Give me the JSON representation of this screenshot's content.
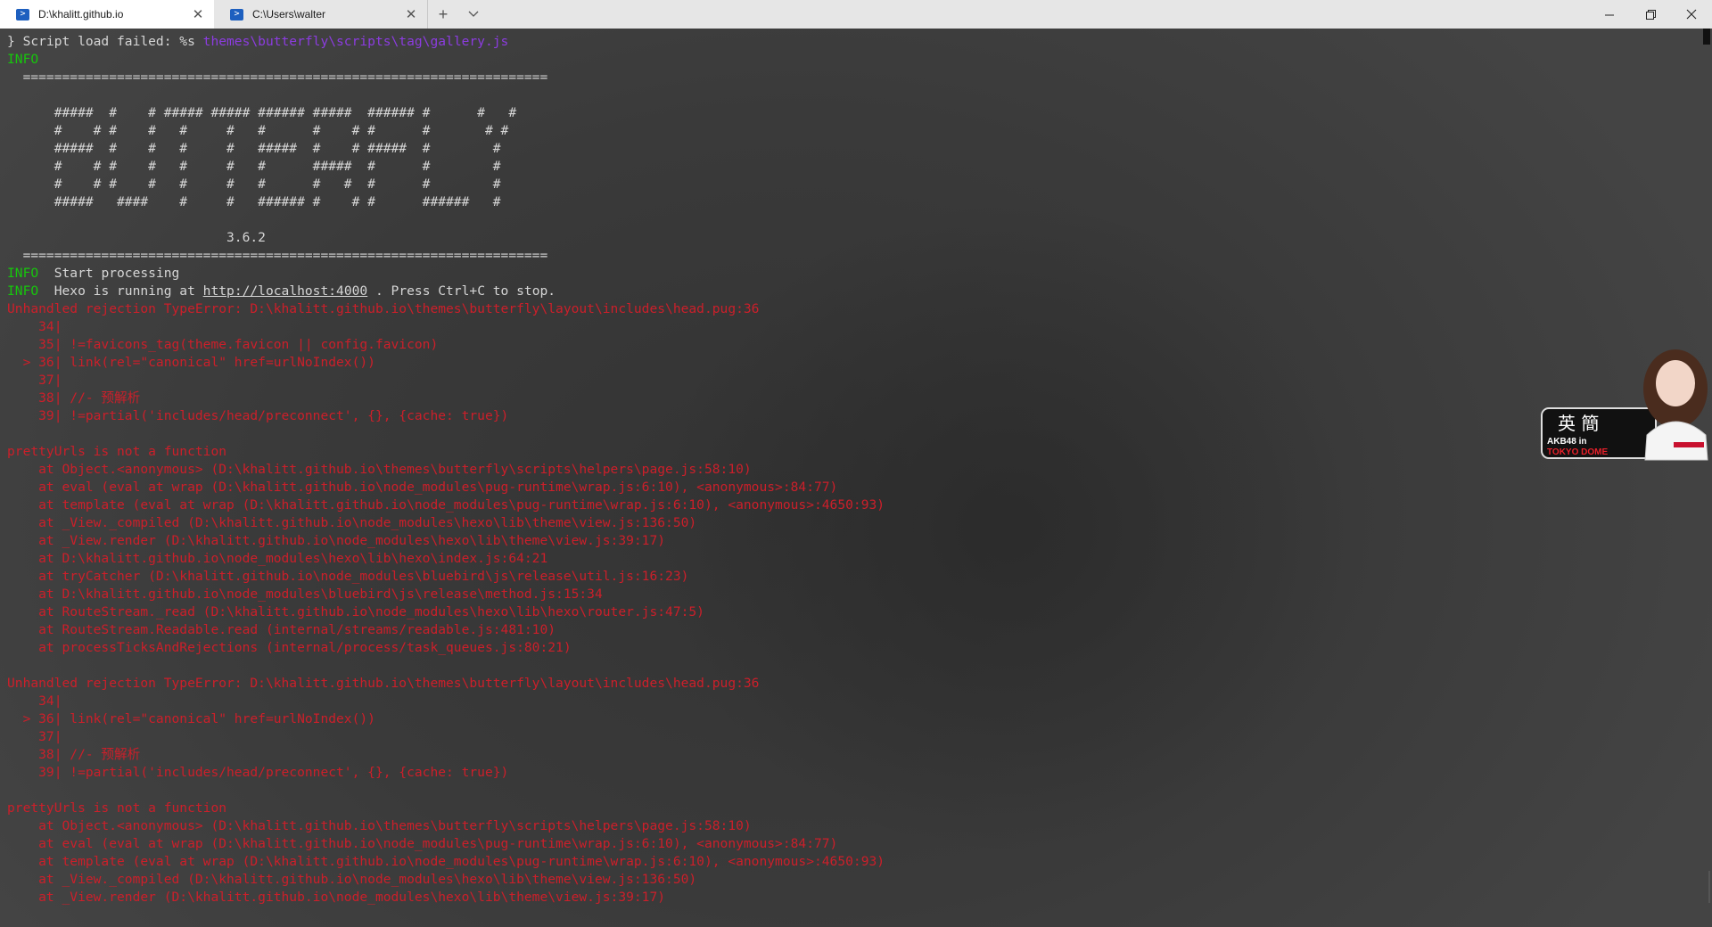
{
  "tabs": [
    {
      "label": "D:\\khalitt.github.io",
      "icon": "powershell-icon",
      "active": true
    },
    {
      "label": "C:\\Users\\walter",
      "icon": "powershell-icon",
      "active": false
    }
  ],
  "window_controls": {
    "minimize": "—",
    "maximize": "❐",
    "close": "✕",
    "new_tab": "+",
    "dropdown": "⌵"
  },
  "sticker": {
    "line1": "英 簡",
    "line2": "AKB48 in",
    "line3": "TOKYO DOME"
  },
  "terminal_lines": [
    [
      {
        "t": "} Script load failed: %s ",
        "c": "white"
      },
      {
        "t": "themes\\butterfly\\scripts\\tag\\gallery.js",
        "c": "purple"
      }
    ],
    [
      {
        "t": "INFO",
        "c": "info"
      }
    ],
    [
      {
        "t": "  ===================================================================",
        "c": "white"
      }
    ],
    [
      {
        "t": "",
        "c": "white"
      }
    ],
    [
      {
        "t": "      #####  #    # ##### ##### ###### #####  ###### #      #   #",
        "c": "white"
      }
    ],
    [
      {
        "t": "      #    # #    #   #     #   #      #    # #      #       # #",
        "c": "white"
      }
    ],
    [
      {
        "t": "      #####  #    #   #     #   #####  #    # #####  #        #",
        "c": "white"
      }
    ],
    [
      {
        "t": "      #    # #    #   #     #   #      #####  #      #        #",
        "c": "white"
      }
    ],
    [
      {
        "t": "      #    # #    #   #     #   #      #   #  #      #        #",
        "c": "white"
      }
    ],
    [
      {
        "t": "      #####   ####    #     #   ###### #    # #      ######   #",
        "c": "white"
      }
    ],
    [
      {
        "t": "",
        "c": "white"
      }
    ],
    [
      {
        "t": "                            3.6.2",
        "c": "white"
      }
    ],
    [
      {
        "t": "  ===================================================================",
        "c": "white"
      }
    ],
    [
      {
        "t": "INFO",
        "c": "info"
      },
      {
        "t": "  Start processing",
        "c": "white"
      }
    ],
    [
      {
        "t": "INFO",
        "c": "info"
      },
      {
        "t": "  Hexo is running at ",
        "c": "white"
      },
      {
        "t": "http://localhost:4000",
        "c": "white",
        "u": true
      },
      {
        "t": " . Press Ctrl+C to stop.",
        "c": "white"
      }
    ],
    [
      {
        "t": "Unhandled rejection TypeError: D:\\khalitt.github.io\\themes\\butterfly\\layout\\includes\\head.pug:36",
        "c": "red"
      }
    ],
    [
      {
        "t": "    34|",
        "c": "red"
      }
    ],
    [
      {
        "t": "    35| !=favicons_tag(theme.favicon || config.favicon)",
        "c": "red"
      }
    ],
    [
      {
        "t": "  > 36| link(rel=\"canonical\" href=urlNoIndex())",
        "c": "red"
      }
    ],
    [
      {
        "t": "    37|",
        "c": "red"
      }
    ],
    [
      {
        "t": "    38| //- 预解析",
        "c": "red"
      }
    ],
    [
      {
        "t": "    39| !=partial('includes/head/preconnect', {}, {cache: true})",
        "c": "red"
      }
    ],
    [
      {
        "t": "",
        "c": "red"
      }
    ],
    [
      {
        "t": "prettyUrls is not a function",
        "c": "red"
      }
    ],
    [
      {
        "t": "    at Object.<anonymous> (D:\\khalitt.github.io\\themes\\butterfly\\scripts\\helpers\\page.js:58:10)",
        "c": "red"
      }
    ],
    [
      {
        "t": "    at eval (eval at wrap (D:\\khalitt.github.io\\node_modules\\pug-runtime\\wrap.js:6:10), <anonymous>:84:77)",
        "c": "red"
      }
    ],
    [
      {
        "t": "    at template (eval at wrap (D:\\khalitt.github.io\\node_modules\\pug-runtime\\wrap.js:6:10), <anonymous>:4650:93)",
        "c": "red"
      }
    ],
    [
      {
        "t": "    at _View._compiled (D:\\khalitt.github.io\\node_modules\\hexo\\lib\\theme\\view.js:136:50)",
        "c": "red"
      }
    ],
    [
      {
        "t": "    at _View.render (D:\\khalitt.github.io\\node_modules\\hexo\\lib\\theme\\view.js:39:17)",
        "c": "red"
      }
    ],
    [
      {
        "t": "    at D:\\khalitt.github.io\\node_modules\\hexo\\lib\\hexo\\index.js:64:21",
        "c": "red"
      }
    ],
    [
      {
        "t": "    at tryCatcher (D:\\khalitt.github.io\\node_modules\\bluebird\\js\\release\\util.js:16:23)",
        "c": "red"
      }
    ],
    [
      {
        "t": "    at D:\\khalitt.github.io\\node_modules\\bluebird\\js\\release\\method.js:15:34",
        "c": "red"
      }
    ],
    [
      {
        "t": "    at RouteStream._read (D:\\khalitt.github.io\\node_modules\\hexo\\lib\\hexo\\router.js:47:5)",
        "c": "red"
      }
    ],
    [
      {
        "t": "    at RouteStream.Readable.read (internal/streams/readable.js:481:10)",
        "c": "red"
      }
    ],
    [
      {
        "t": "    at processTicksAndRejections (internal/process/task_queues.js:80:21)",
        "c": "red"
      }
    ],
    [
      {
        "t": "",
        "c": "red"
      }
    ],
    [
      {
        "t": "Unhandled rejection TypeError: D:\\khalitt.github.io\\themes\\butterfly\\layout\\includes\\head.pug:36",
        "c": "red"
      }
    ],
    [
      {
        "t": "    34|",
        "c": "red"
      }
    ],
    [
      {
        "t": "  > 36| link(rel=\"canonical\" href=urlNoIndex())",
        "c": "red"
      }
    ],
    [
      {
        "t": "    37|",
        "c": "red"
      }
    ],
    [
      {
        "t": "    38| //- 预解析",
        "c": "red"
      }
    ],
    [
      {
        "t": "    39| !=partial('includes/head/preconnect', {}, {cache: true})",
        "c": "red"
      }
    ],
    [
      {
        "t": "",
        "c": "red"
      }
    ],
    [
      {
        "t": "prettyUrls is not a function",
        "c": "red"
      }
    ],
    [
      {
        "t": "    at Object.<anonymous> (D:\\khalitt.github.io\\themes\\butterfly\\scripts\\helpers\\page.js:58:10)",
        "c": "red"
      }
    ],
    [
      {
        "t": "    at eval (eval at wrap (D:\\khalitt.github.io\\node_modules\\pug-runtime\\wrap.js:6:10), <anonymous>:84:77)",
        "c": "red"
      }
    ],
    [
      {
        "t": "    at template (eval at wrap (D:\\khalitt.github.io\\node_modules\\pug-runtime\\wrap.js:6:10), <anonymous>:4650:93)",
        "c": "red"
      }
    ],
    [
      {
        "t": "    at _View._compiled (D:\\khalitt.github.io\\node_modules\\hexo\\lib\\theme\\view.js:136:50)",
        "c": "red"
      }
    ],
    [
      {
        "t": "    at _View.render (D:\\khalitt.github.io\\node_modules\\hexo\\lib\\theme\\view.js:39:17)",
        "c": "red"
      }
    ]
  ]
}
